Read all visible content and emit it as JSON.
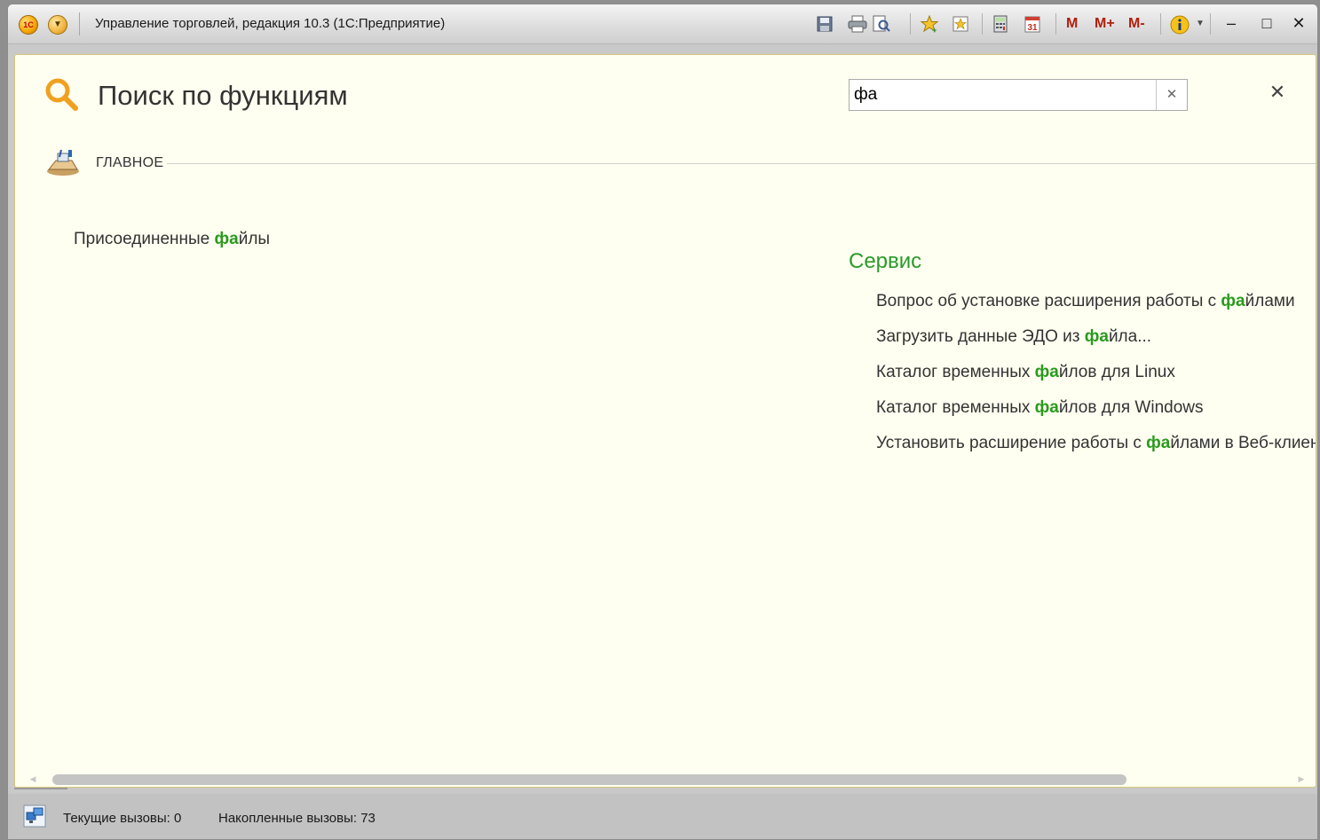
{
  "window": {
    "title": "Управление торговлей, редакция 10.3  (1С:Предприятие)",
    "logo_text": "1С",
    "toolbar": {
      "m_label": "M",
      "m_plus_label": "M+",
      "m_minus_label": "M-",
      "calendar_day": "31"
    }
  },
  "panel": {
    "title": "Поиск по функциям",
    "search": {
      "value": "фа"
    }
  },
  "section": {
    "label": "ГЛАВНОЕ"
  },
  "results": {
    "left_items": [
      {
        "before": "Присоединенные ",
        "match": "фа",
        "after": "йлы"
      }
    ],
    "group": {
      "title": "Сервис",
      "items": [
        {
          "before": "Вопрос об установке расширения работы с ",
          "match": "фа",
          "after": "йлами"
        },
        {
          "before": "Загрузить данные ЭДО из ",
          "match": "фа",
          "after": "йла..."
        },
        {
          "before": "Каталог временных ",
          "match": "фа",
          "after": "йлов для Linux"
        },
        {
          "before": "Каталог временных ",
          "match": "фа",
          "after": "йлов для Windows"
        },
        {
          "before": "Установить расширение работы с ",
          "match": "фа",
          "after": "йлами в Веб-клиенте"
        }
      ]
    }
  },
  "status": {
    "current_calls": "Текущие вызовы: 0",
    "accumulated_calls": "Накопленные вызовы: 73"
  },
  "colors": {
    "content_bg": "#fffff1",
    "match_highlight": "#2a9a1e",
    "group_title": "#2a9a2a",
    "search_icon": "#f0a020"
  }
}
